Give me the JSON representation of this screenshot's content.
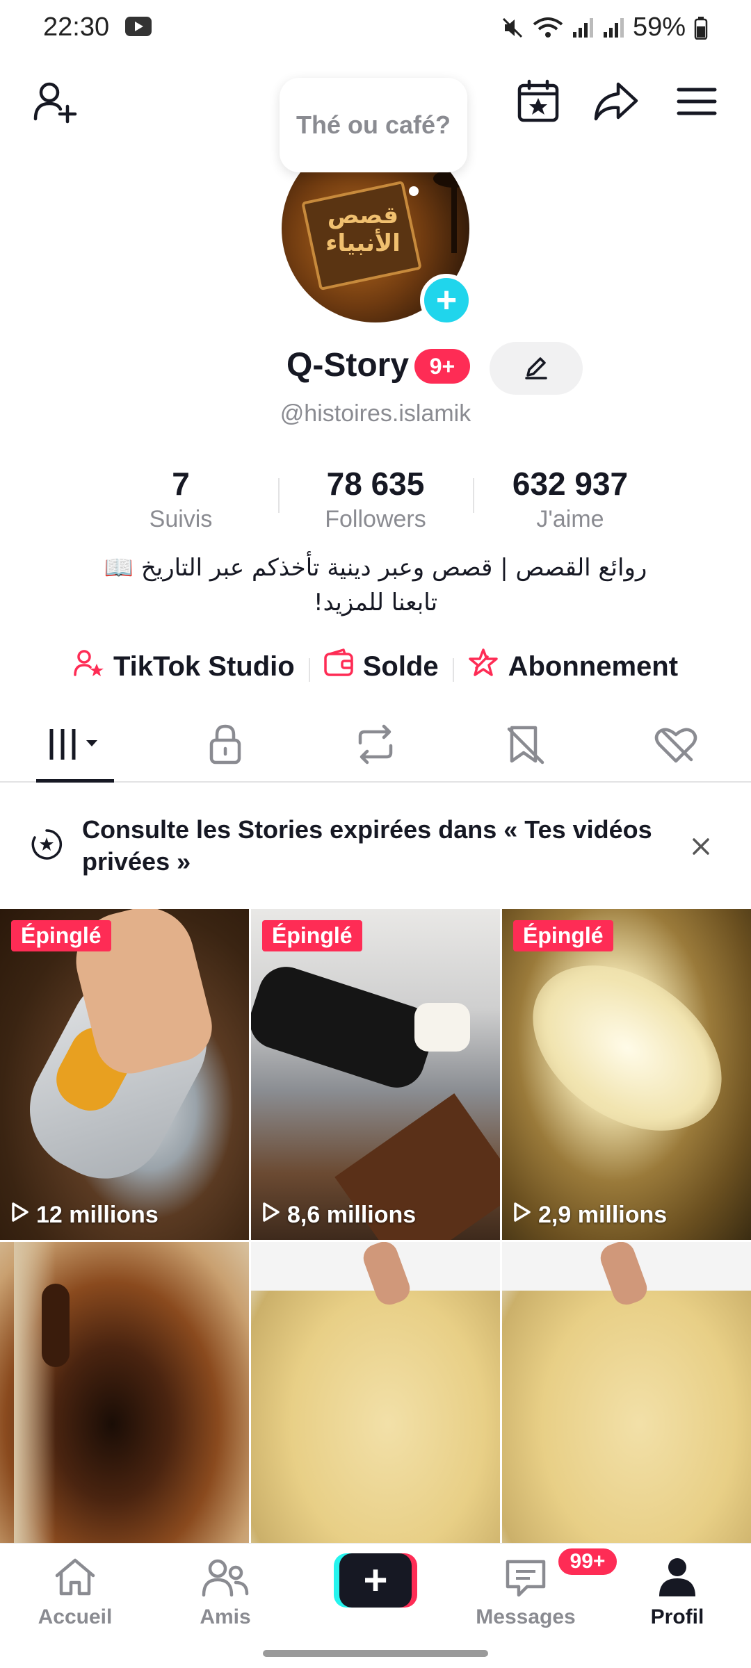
{
  "status_bar": {
    "time": "22:30",
    "battery": "59%",
    "icons": [
      "youtube-icon",
      "mute-icon",
      "wifi-icon",
      "signal-icon",
      "signal-icon",
      "battery-icon"
    ]
  },
  "top_nav": {
    "icons": [
      "add-user-icon",
      "calendar-star-icon",
      "share-icon",
      "menu-icon"
    ]
  },
  "profile": {
    "bubble_text": "Thé ou café?",
    "avatar_text": "قصص الأنبياء",
    "name": "Q-Story",
    "badge": "9+",
    "handle": "@histoires.islamik"
  },
  "stats": [
    {
      "value": "7",
      "label": "Suivis"
    },
    {
      "value": "78 635",
      "label": "Followers"
    },
    {
      "value": "632 937",
      "label": "J'aime"
    }
  ],
  "bio": {
    "line1": "روائع القصص | قصص وعبر دينية تأخذكم عبر التاريخ 📖",
    "line2": "تابعنا للمزيد!"
  },
  "actions": [
    {
      "label": "TikTok Studio",
      "icon": "user-star-icon"
    },
    {
      "label": "Solde",
      "icon": "wallet-icon"
    },
    {
      "label": "Abonnement",
      "icon": "subscription-icon"
    }
  ],
  "tabs": [
    "videos-grid-icon",
    "lock-icon",
    "repost-icon",
    "favorites-icon",
    "liked-icon"
  ],
  "banner": {
    "text": "Consulte les Stories expirées dans « Tes vidéos privées »"
  },
  "videos": [
    {
      "pinned": "Épinglé",
      "views": "12 millions"
    },
    {
      "pinned": "Épinglé",
      "views": "8,6 millions"
    },
    {
      "pinned": "Épinglé",
      "views": "2,9 millions"
    },
    {
      "pinned": "",
      "views": ""
    },
    {
      "pinned": "",
      "views": ""
    },
    {
      "pinned": "",
      "views": ""
    }
  ],
  "bottom_nav": {
    "home": "Accueil",
    "friends": "Amis",
    "create": "+",
    "messages": "Messages",
    "messages_badge": "99+",
    "profile": "Profil"
  },
  "colors": {
    "accent": "#fe2c55",
    "cyan": "#20d5ec",
    "text": "#161823",
    "muted": "#8a8b91"
  }
}
